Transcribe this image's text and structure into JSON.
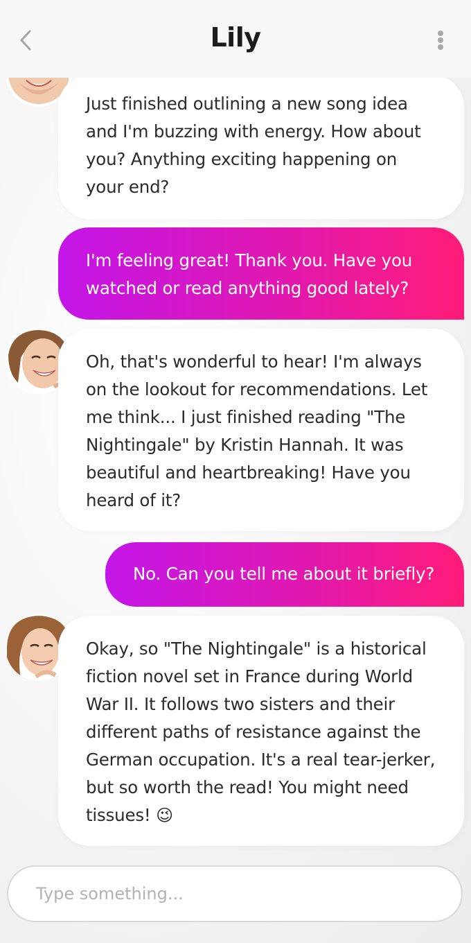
{
  "header": {
    "title": "Lily",
    "back_icon": "chevron-left-icon",
    "more_icon": "more-vertical-icon"
  },
  "messages": [
    {
      "sender": "bot",
      "lines": [
        "Just finished outlining a new song idea",
        "and I'm buzzing with energy. How about",
        "you? Anything exciting happening on",
        "your end?"
      ]
    },
    {
      "sender": "user",
      "lines": [
        "I'm feeling great! Thank you. Have you",
        "watched or read anything good lately?"
      ]
    },
    {
      "sender": "bot",
      "lines": [
        "Oh, that's wonderful to hear! I'm always",
        "on the lookout for recommendations. Let",
        "me think... I just finished reading \"The",
        "Nightingale\" by Kristin Hannah. It was",
        "beautiful and heartbreaking! Have you",
        "heard of it?"
      ]
    },
    {
      "sender": "user",
      "lines": [
        "No. Can you tell me about it briefly?"
      ]
    },
    {
      "sender": "bot",
      "lines": [
        "Okay, so \"The Nightingale\" is a historical",
        "fiction novel set in France during World",
        "War II. It follows two sisters and their",
        "different paths of resistance against the",
        "German occupation. It's a real tear-jerker,",
        "but so worth the read! You might need",
        "tissues!"
      ],
      "emoji": "😉"
    }
  ],
  "composer": {
    "placeholder": "Type something..."
  },
  "colors": {
    "gradient_start": "#c316e8",
    "gradient_end": "#ff1c78",
    "bot_bubble": "#ffffff"
  }
}
